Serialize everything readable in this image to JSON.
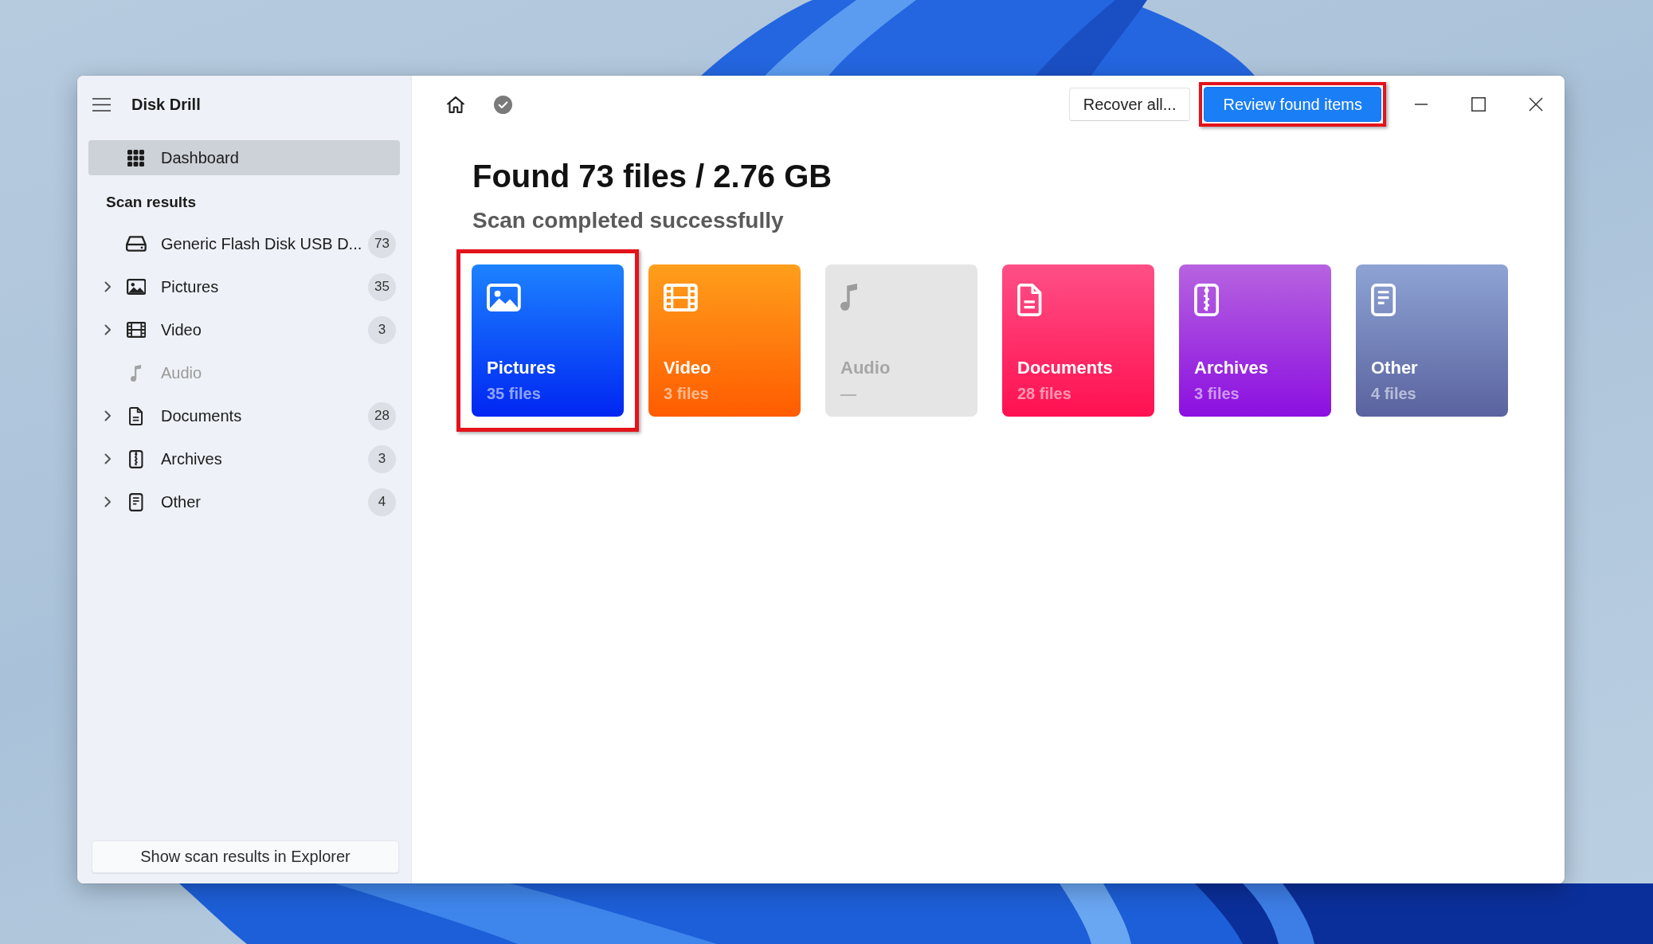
{
  "window": {
    "title": "Disk Drill"
  },
  "sidebar": {
    "nav": [
      {
        "label": "Dashboard",
        "selected": true
      }
    ],
    "section_title": "Scan results",
    "items": [
      {
        "label": "Generic Flash Disk USB D...",
        "kind": "drive",
        "count": "73",
        "expandable": false,
        "disabled": false,
        "selected": false
      },
      {
        "label": "Pictures",
        "kind": "pictures",
        "count": "35",
        "expandable": true,
        "disabled": false,
        "selected": false
      },
      {
        "label": "Video",
        "kind": "video",
        "count": "3",
        "expandable": true,
        "disabled": false,
        "selected": false
      },
      {
        "label": "Audio",
        "kind": "audio",
        "expandable": false,
        "disabled": true,
        "selected": false
      },
      {
        "label": "Documents",
        "kind": "documents",
        "count": "28",
        "expandable": true,
        "disabled": false,
        "selected": false
      },
      {
        "label": "Archives",
        "kind": "archives",
        "count": "3",
        "expandable": true,
        "disabled": false,
        "selected": false
      },
      {
        "label": "Other",
        "kind": "other",
        "count": "4",
        "expandable": true,
        "disabled": false,
        "selected": false
      }
    ],
    "footer_button": "Show scan results in Explorer"
  },
  "toolbar": {
    "buttons": [
      {
        "label": "Recover all...",
        "kind": "secondary",
        "highlighted": false
      },
      {
        "label": "Review found items",
        "kind": "primary",
        "highlighted": true
      }
    ]
  },
  "summary": {
    "title": "Found 73 files / 2.76 GB",
    "subtitle": "Scan completed successfully"
  },
  "categories": [
    {
      "label": "Pictures",
      "kind": "pictures",
      "count": "35 files",
      "disabled": false,
      "highlighted": true
    },
    {
      "label": "Video",
      "kind": "video",
      "count": "3 files",
      "disabled": false,
      "highlighted": false
    },
    {
      "label": "Audio",
      "kind": "audio",
      "count": "—",
      "disabled": true,
      "highlighted": false
    },
    {
      "label": "Documents",
      "kind": "documents",
      "count": "28 files",
      "disabled": false,
      "highlighted": false
    },
    {
      "label": "Archives",
      "kind": "archives",
      "count": "3 files",
      "disabled": false,
      "highlighted": false
    },
    {
      "label": "Other",
      "kind": "other",
      "count": "4 files",
      "disabled": false,
      "highlighted": false
    }
  ]
}
